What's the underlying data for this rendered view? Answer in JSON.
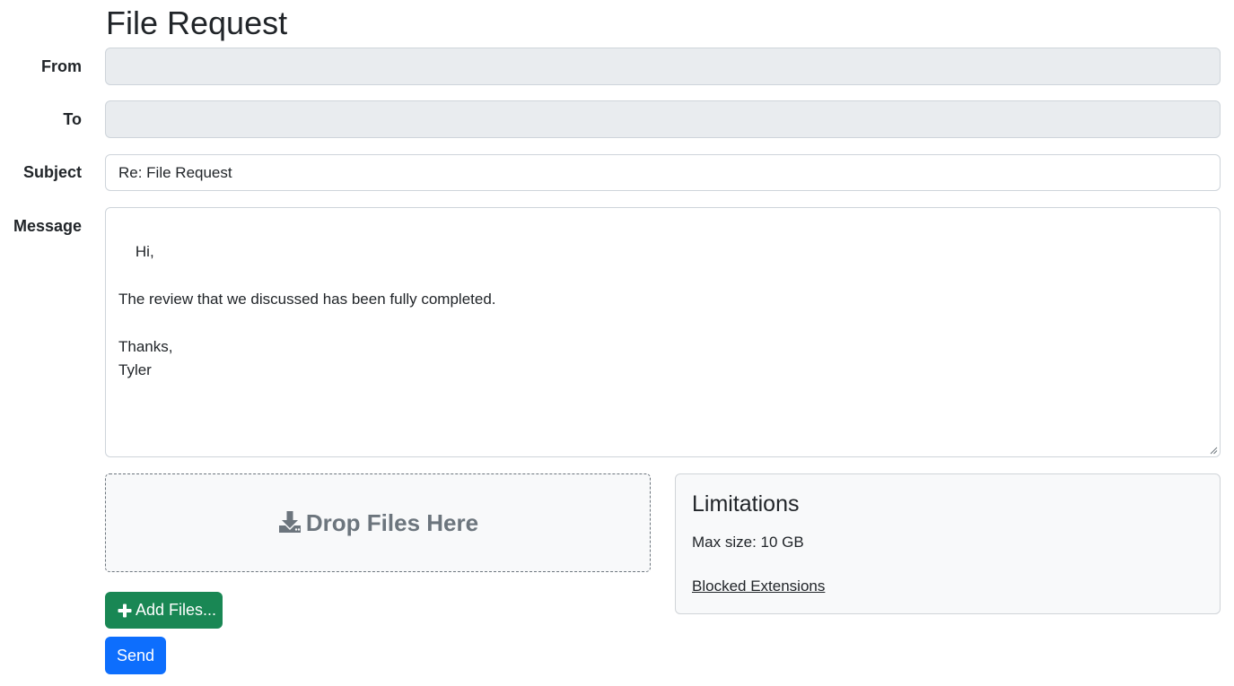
{
  "page": {
    "title": "File Request"
  },
  "form": {
    "from": {
      "label": "From",
      "value": ""
    },
    "to": {
      "label": "To",
      "value": ""
    },
    "subject": {
      "label": "Subject",
      "value": "Re: File Request"
    },
    "message": {
      "label": "Message",
      "value": "Hi,\n\nThe review that we discussed has been fully completed.\n\nThanks,\nTyler"
    }
  },
  "dropzone": {
    "text": "Drop Files Here",
    "icon": "download-icon"
  },
  "limitations": {
    "title": "Limitations",
    "max_size": "Max size: 10 GB",
    "blocked_link": "Blocked Extensions"
  },
  "buttons": {
    "add_files": "Add Files...",
    "add_files_icon": "plus-icon",
    "send": "Send"
  },
  "colors": {
    "success": "#198754",
    "primary": "#0d6efd",
    "disabled_bg": "#e9ecef",
    "muted": "#6c757d"
  }
}
